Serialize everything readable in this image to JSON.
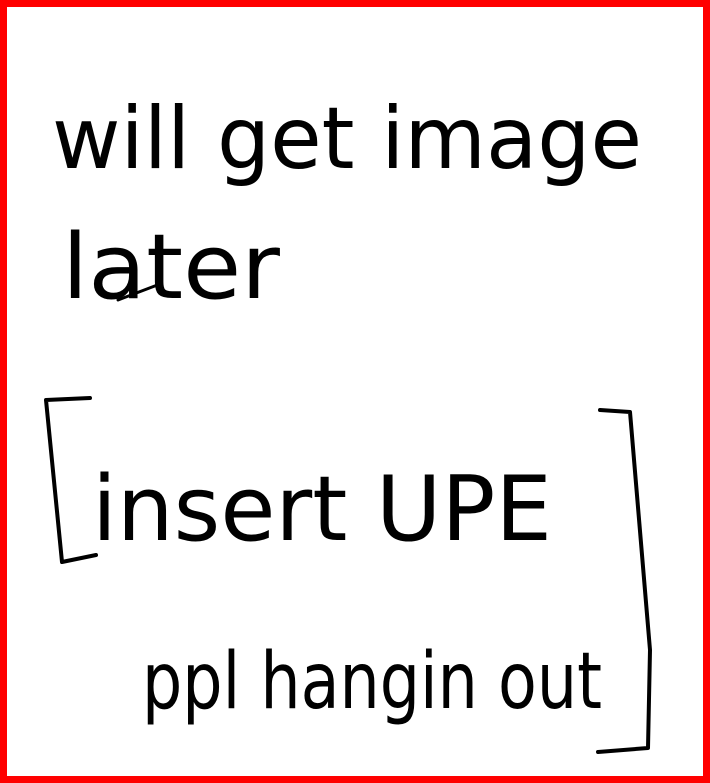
{
  "note": {
    "line1": "will get image",
    "line2": "later",
    "line3": "insert UPE",
    "line4": "ppl hangin out"
  },
  "colors": {
    "border": "#ff0000",
    "ink": "#000000",
    "background": "#ffffff"
  }
}
